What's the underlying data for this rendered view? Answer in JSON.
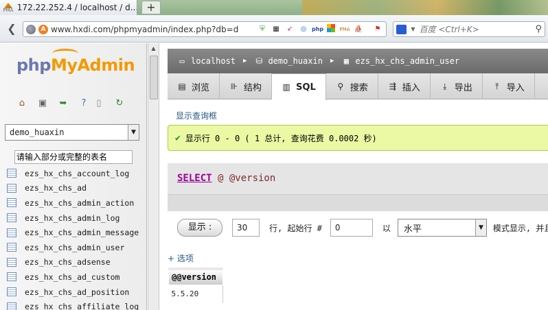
{
  "browser": {
    "tab_title": "172.22.252.4 / localhost / d...",
    "tab_favicon_label": "PMA",
    "new_tab_symbol": "+",
    "url": "www.hxdi.com/phpmyadmin/index.php?db=d",
    "search_placeholder": "百度 <Ctrl+K>",
    "addon_php_label": "php",
    "addon_pma_label": "PMA"
  },
  "left": {
    "logo_php": "php",
    "logo_my": "MyAdmin",
    "db_selected": "demo_huaxin",
    "filter_placeholder": "请输入部分或完整的表名",
    "tables": [
      "ezs_hx_chs_account_log",
      "ezs_hx_chs_ad",
      "ezs_hx_chs_admin_action",
      "ezs_hx_chs_admin_log",
      "ezs_hx_chs_admin_message",
      "ezs_hx_chs_admin_user",
      "ezs_hx_chs_adsense",
      "ezs_hx_chs_ad_custom",
      "ezs_hx_chs_ad_position",
      "ezs_hx_chs_affiliate_log"
    ]
  },
  "breadcrumb": {
    "server": "localhost",
    "database": "demo_huaxin",
    "table": "ezs_hx_chs_admin_user"
  },
  "tabs": [
    {
      "label": "浏览",
      "icon": "browse-icon"
    },
    {
      "label": "结构",
      "icon": "structure-icon"
    },
    {
      "label": "SQL",
      "icon": "sql-icon",
      "active": true
    },
    {
      "label": "搜索",
      "icon": "search-icon"
    },
    {
      "label": "插入",
      "icon": "insert-icon"
    },
    {
      "label": "导出",
      "icon": "export-icon"
    },
    {
      "label": "导入",
      "icon": "import-icon"
    }
  ],
  "main": {
    "show_query_link": "显示查询框",
    "success_message": "显示行 0 - 0 ( 1 总计, 查询花费 0.0002 秒)",
    "sql_keyword": "SELECT",
    "sql_rest": " @ @version",
    "show_button": "显示 :",
    "rows_value": "30",
    "rows_text": "行, 起始行 #",
    "start_value": "0",
    "mode_prefix": "以",
    "mode_selected": "水平",
    "mode_suffix": "模式显示, 并且",
    "options_link": "+ 选项",
    "result_header": "@@version",
    "result_value": "5.5.20"
  },
  "colors": {
    "success_bg": "#ebf8a4",
    "success_border": "#a2d246",
    "breadcrumb_bg": "#7a7a7a",
    "sql_keyword": "#990099",
    "link": "#235a81"
  }
}
